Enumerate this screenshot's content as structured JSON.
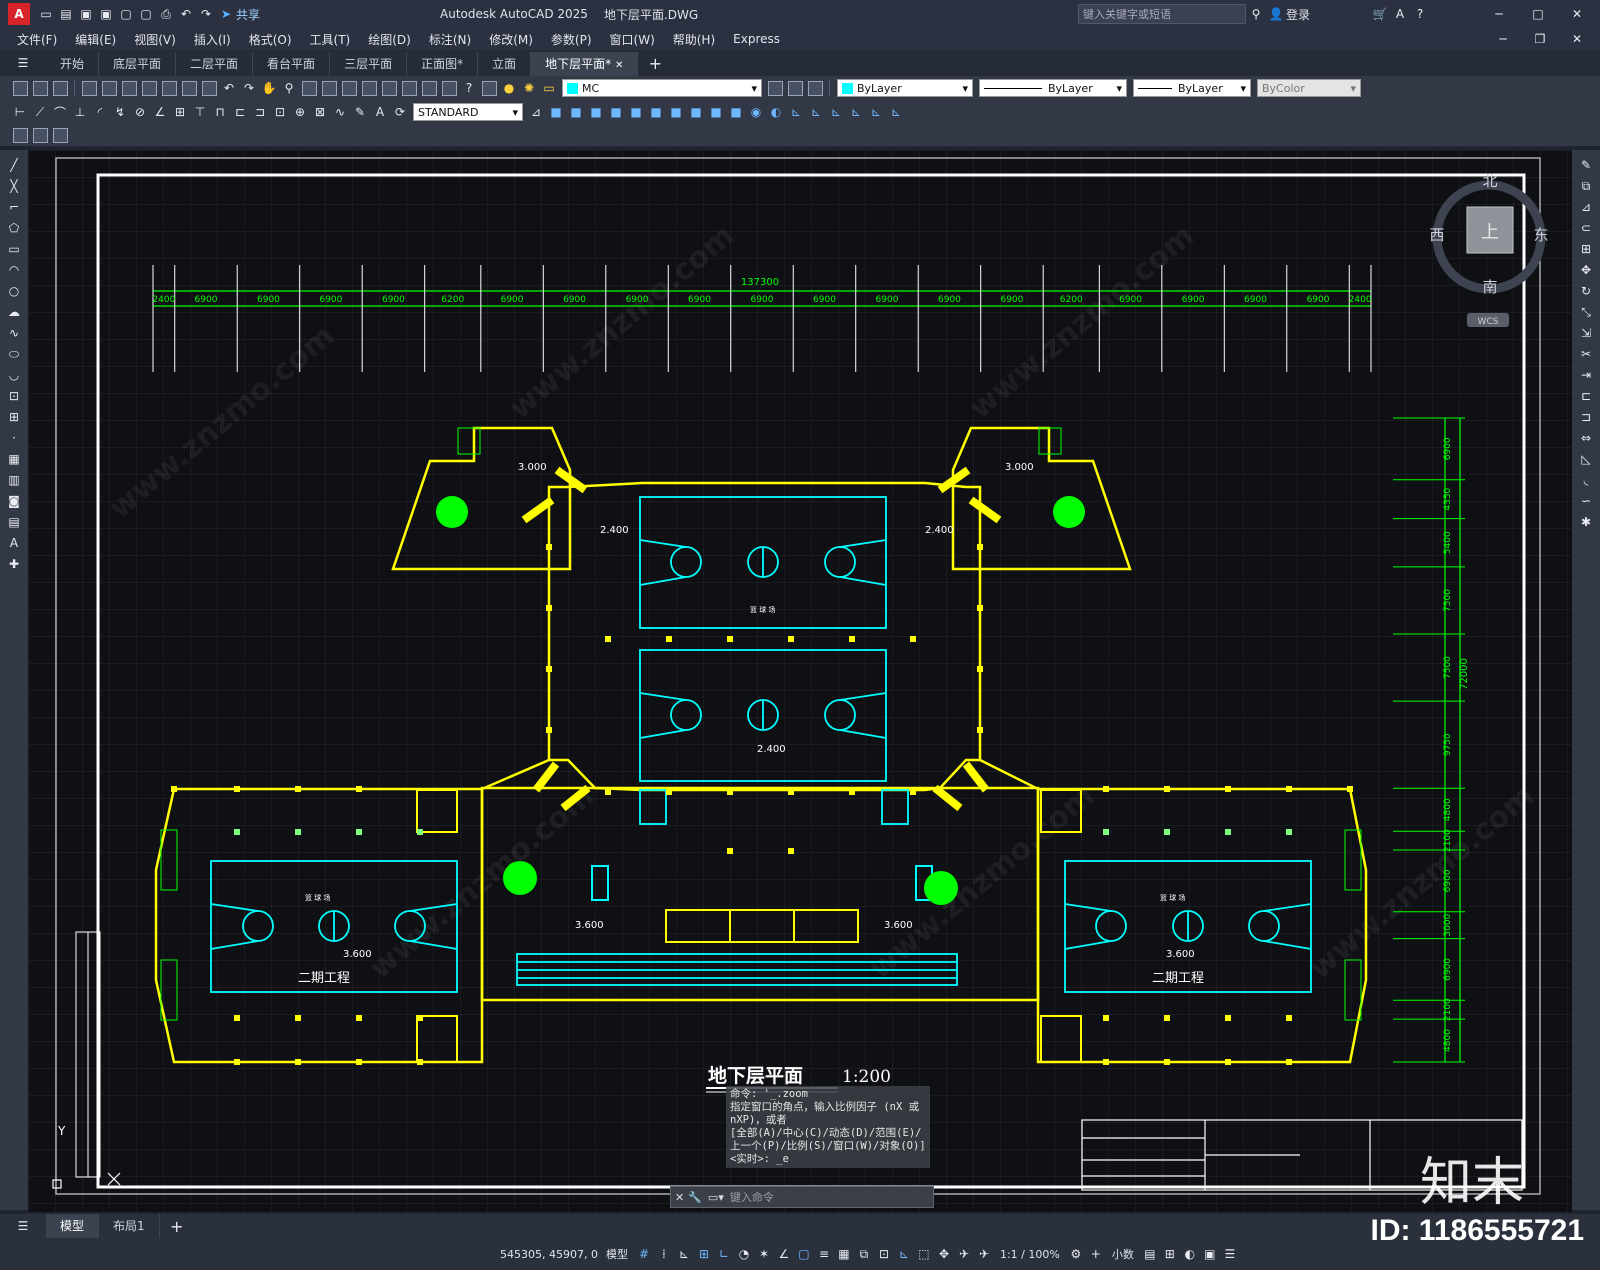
{
  "window": {
    "app_title": "Autodesk AutoCAD 2025",
    "doc_title": "地下层平面.DWG",
    "share": "共享",
    "search_placeholder": "键入关键字或短语",
    "login": "登录"
  },
  "menu": [
    "文件(F)",
    "编辑(E)",
    "视图(V)",
    "插入(I)",
    "格式(O)",
    "工具(T)",
    "绘图(D)",
    "标注(N)",
    "修改(M)",
    "参数(P)",
    "窗口(W)",
    "帮助(H)",
    "Express"
  ],
  "file_tabs": [
    "开始",
    "底层平面",
    "二层平面",
    "看台平面",
    "三层平面",
    "正面图*",
    "立面",
    "地下层平面*"
  ],
  "toolbar": {
    "layer": "MC",
    "color": "ByLayer",
    "linetype": "ByLayer",
    "lineweight": "ByLayer",
    "plotstyle": "ByColor",
    "textstyle": "STANDARD"
  },
  "viewcube": {
    "north": "北",
    "south": "南",
    "east": "东",
    "west": "西",
    "top": "上",
    "wcs": "WCS"
  },
  "drawing": {
    "overall_dim": "137300",
    "top_dims": [
      "2400",
      "6900",
      "6900",
      "6900",
      "6900",
      "6200",
      "6900",
      "6900",
      "6900",
      "6900",
      "6900",
      "6900",
      "6900",
      "6900",
      "6900",
      "6200",
      "6900",
      "6900",
      "6900",
      "6900",
      "2400"
    ],
    "right_dims": [
      "6900",
      "4350",
      "5400",
      "7500",
      "7500",
      "9750",
      "4800",
      "2100",
      "6900",
      "3000",
      "6900",
      "2100",
      "4800"
    ],
    "right_total": "72000",
    "elev_3000": "3.000",
    "elev_2400": "2.400",
    "elev_3600": "3.600",
    "phase2": "二期工程",
    "court": "篮 球 场",
    "title": "地下层平面",
    "scale": "1:200"
  },
  "command": {
    "history": [
      "命令: '_.zoom",
      "指定窗口的角点，输入比例因子 (nX 或 nXP)，或者",
      "[全部(A)/中心(C)/动态(D)/范围(E)/上一个(P)/比例(S)/窗口(W)/对象(O)] <实时>: _e"
    ],
    "placeholder": "键入命令"
  },
  "layout_tabs": [
    "模型",
    "布局1"
  ],
  "status": {
    "coords": "545305, 45907, 0",
    "model": "模型",
    "scale": "1:1 / 100%",
    "units": "小数"
  },
  "watermark": {
    "id": "ID: 1186555721",
    "brand": "知末"
  },
  "colors": {
    "wall": "#ffff00",
    "dim": "#00ff00",
    "court": "#00ffff",
    "bg": "#0f1013",
    "frame": "#ffffff"
  }
}
